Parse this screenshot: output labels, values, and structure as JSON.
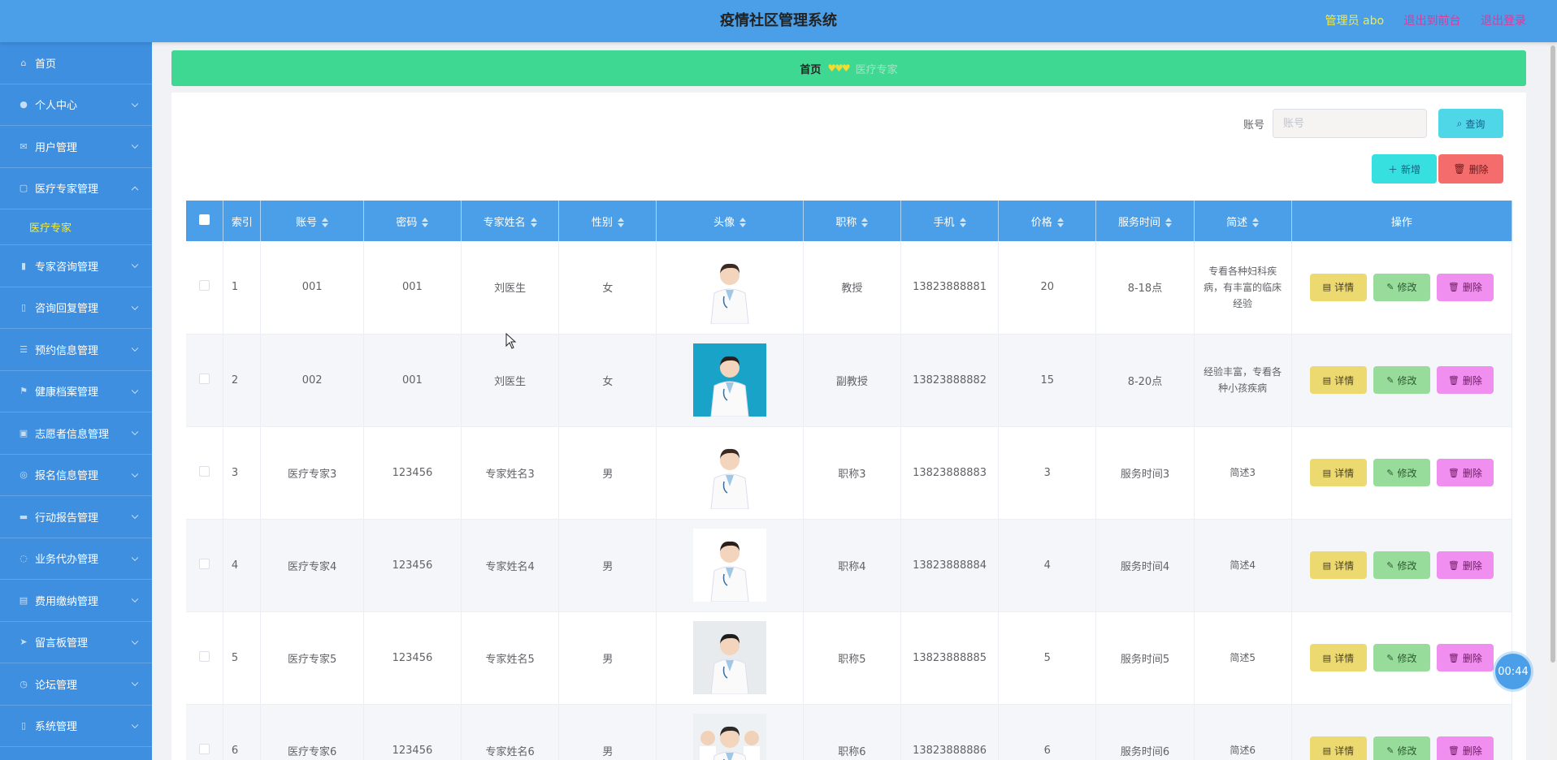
{
  "header": {
    "title": "疫情社区管理系统",
    "admin": "管理员 abo",
    "to_front": "退出到前台",
    "logout": "退出登录"
  },
  "sidebar": {
    "items": [
      {
        "label": "首页",
        "icon": "home-icon",
        "expand": false
      },
      {
        "label": "个人中心",
        "icon": "user-icon",
        "expand": true
      },
      {
        "label": "用户管理",
        "icon": "mail-icon",
        "expand": true
      },
      {
        "label": "医疗专家管理",
        "icon": "doc-icon",
        "expand": true,
        "open": true
      },
      {
        "label": "专家咨询管理",
        "icon": "chart-icon",
        "expand": true
      },
      {
        "label": "咨询回复管理",
        "icon": "mic-icon",
        "expand": true
      },
      {
        "label": "预约信息管理",
        "icon": "sliders-icon",
        "expand": true
      },
      {
        "label": "健康档案管理",
        "icon": "flag-icon",
        "expand": true
      },
      {
        "label": "志愿者信息管理",
        "icon": "briefcase-icon",
        "expand": true
      },
      {
        "label": "报名信息管理",
        "icon": "bell-icon",
        "expand": true
      },
      {
        "label": "行动报告管理",
        "icon": "cup-icon",
        "expand": true
      },
      {
        "label": "业务代办管理",
        "icon": "refresh-icon",
        "expand": true
      },
      {
        "label": "费用缴纳管理",
        "icon": "wallet-icon",
        "expand": true
      },
      {
        "label": "留言板管理",
        "icon": "send-icon",
        "expand": true
      },
      {
        "label": "论坛管理",
        "icon": "clock-icon",
        "expand": true
      },
      {
        "label": "系统管理",
        "icon": "mic-icon",
        "expand": true
      }
    ],
    "submenu": "医疗专家"
  },
  "breadcrumb": {
    "home": "首页",
    "current": "医疗专家"
  },
  "search": {
    "label": "账号",
    "placeholder": "账号",
    "query_btn": "查询"
  },
  "actions": {
    "add": "新增",
    "delete": "删除"
  },
  "table": {
    "columns": [
      "索引",
      "账号",
      "密码",
      "专家姓名",
      "性别",
      "头像",
      "职称",
      "手机",
      "价格",
      "服务时间",
      "简述",
      "操作"
    ],
    "rows": [
      {
        "idx": "1",
        "account": "001",
        "password": "001",
        "name": "刘医生",
        "gender": "女",
        "title": "教授",
        "phone": "13823888881",
        "price": "20",
        "time": "8-18点",
        "desc": "专看各种妇科疾病，有丰富的临床经验"
      },
      {
        "idx": "2",
        "account": "002",
        "password": "001",
        "name": "刘医生",
        "gender": "女",
        "title": "副教授",
        "phone": "13823888882",
        "price": "15",
        "time": "8-20点",
        "desc": "经验丰富，专看各种小孩疾病"
      },
      {
        "idx": "3",
        "account": "医疗专家3",
        "password": "123456",
        "name": "专家姓名3",
        "gender": "男",
        "title": "职称3",
        "phone": "13823888883",
        "price": "3",
        "time": "服务时间3",
        "desc": "简述3"
      },
      {
        "idx": "4",
        "account": "医疗专家4",
        "password": "123456",
        "name": "专家姓名4",
        "gender": "男",
        "title": "职称4",
        "phone": "13823888884",
        "price": "4",
        "time": "服务时间4",
        "desc": "简述4"
      },
      {
        "idx": "5",
        "account": "医疗专家5",
        "password": "123456",
        "name": "专家姓名5",
        "gender": "男",
        "title": "职称5",
        "phone": "13823888885",
        "price": "5",
        "time": "服务时间5",
        "desc": "简述5"
      },
      {
        "idx": "6",
        "account": "医疗专家6",
        "password": "123456",
        "name": "专家姓名6",
        "gender": "男",
        "title": "职称6",
        "phone": "13823888886",
        "price": "6",
        "time": "服务时间6",
        "desc": "简述6"
      }
    ],
    "op_detail": "详情",
    "op_edit": "修改",
    "op_delete": "删除"
  },
  "timer": "00:44",
  "colors": {
    "header": "#4a9fe8",
    "sidebar": "#3f8fe0",
    "breadcrumb": "#3fd893",
    "active_sub": "#f4ec3a"
  }
}
